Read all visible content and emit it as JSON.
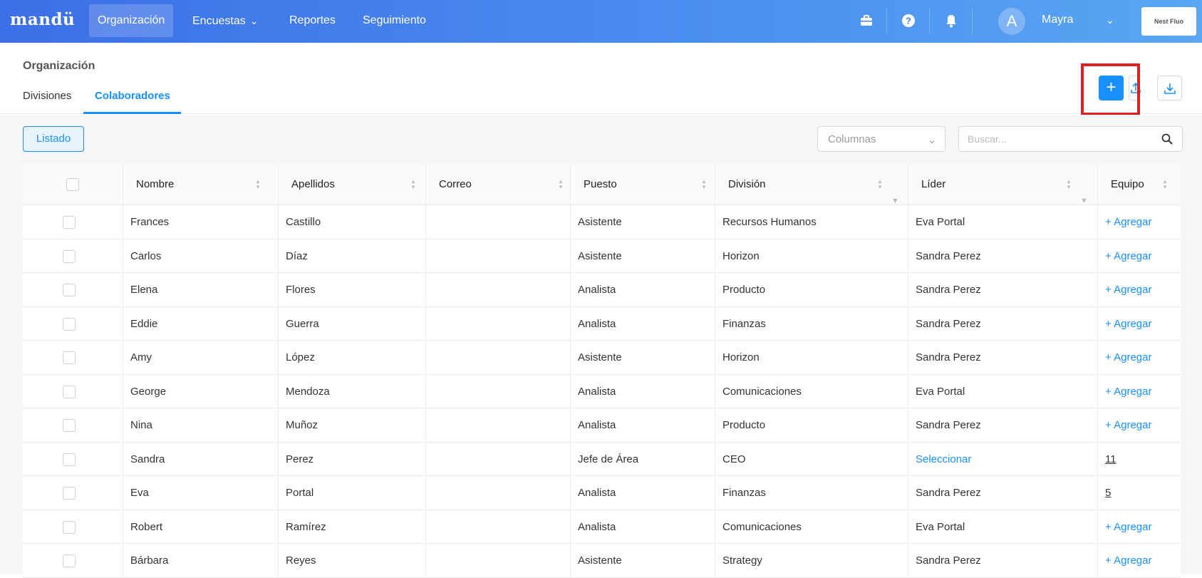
{
  "topbar": {
    "logo": "mandü",
    "nav": [
      {
        "label": "Organización",
        "active": true
      },
      {
        "label": "Encuestas",
        "dropdown": true
      },
      {
        "label": "Reportes"
      },
      {
        "label": "Seguimiento"
      }
    ],
    "icons": [
      "briefcase-icon",
      "help-icon",
      "bell-icon"
    ],
    "avatar_initial": "A",
    "user_name": "Mayra",
    "company_label": "Nest Fluo"
  },
  "page": {
    "title": "Organización",
    "tabs": [
      {
        "label": "Divisiones",
        "active": false
      },
      {
        "label": "Colaboradores",
        "active": true
      }
    ],
    "actions": {
      "add": "+"
    }
  },
  "toolbar": {
    "listado_label": "Listado",
    "columns_placeholder": "Columnas",
    "search_placeholder": "Buscar..."
  },
  "table": {
    "columns": [
      "Nombre",
      "Apellidos",
      "Correo",
      "Puesto",
      "División",
      "Líder",
      "Equipo"
    ],
    "rows": [
      {
        "nombre": "Frances",
        "apellidos": "Castillo",
        "correo": "",
        "puesto": "Asistente",
        "division": "Recursos Humanos",
        "lider": "Eva Portal",
        "lider_link": false,
        "equipo": "+ Agregar",
        "equipo_type": "add"
      },
      {
        "nombre": "Carlos",
        "apellidos": "Díaz",
        "correo": "",
        "puesto": "Asistente",
        "division": "Horizon",
        "lider": "Sandra Perez",
        "lider_link": false,
        "equipo": "+ Agregar",
        "equipo_type": "add"
      },
      {
        "nombre": "Elena",
        "apellidos": "Flores",
        "correo": "",
        "puesto": "Analista",
        "division": "Producto",
        "lider": "Sandra Perez",
        "lider_link": false,
        "equipo": "+ Agregar",
        "equipo_type": "add"
      },
      {
        "nombre": "Eddie",
        "apellidos": "Guerra",
        "correo": "",
        "puesto": "Analista",
        "division": "Finanzas",
        "lider": "Sandra Perez",
        "lider_link": false,
        "equipo": "+ Agregar",
        "equipo_type": "add"
      },
      {
        "nombre": "Amy",
        "apellidos": "López",
        "correo": "",
        "puesto": "Asistente",
        "division": "Horizon",
        "lider": "Sandra Perez",
        "lider_link": false,
        "equipo": "+ Agregar",
        "equipo_type": "add"
      },
      {
        "nombre": "George",
        "apellidos": "Mendoza",
        "correo": "",
        "puesto": "Analista",
        "division": "Comunicaciones",
        "lider": "Eva Portal",
        "lider_link": false,
        "equipo": "+ Agregar",
        "equipo_type": "add"
      },
      {
        "nombre": "Nina",
        "apellidos": "Muñoz",
        "correo": "",
        "puesto": "Analista",
        "division": "Producto",
        "lider": "Sandra Perez",
        "lider_link": false,
        "equipo": "+ Agregar",
        "equipo_type": "add"
      },
      {
        "nombre": "Sandra",
        "apellidos": "Perez",
        "correo": "",
        "puesto": "Jefe de Área",
        "division": "CEO",
        "lider": "Seleccionar",
        "lider_link": true,
        "equipo": "11",
        "equipo_type": "count"
      },
      {
        "nombre": "Eva",
        "apellidos": "Portal",
        "correo": "",
        "puesto": "Analista",
        "division": "Finanzas",
        "lider": "Sandra Perez",
        "lider_link": false,
        "equipo": "5",
        "equipo_type": "count"
      },
      {
        "nombre": "Robert",
        "apellidos": "Ramírez",
        "correo": "",
        "puesto": "Analista",
        "division": "Comunicaciones",
        "lider": "Eva Portal",
        "lider_link": false,
        "equipo": "+ Agregar",
        "equipo_type": "add"
      },
      {
        "nombre": "Bárbara",
        "apellidos": "Reyes",
        "correo": "",
        "puesto": "Asistente",
        "division": "Strategy",
        "lider": "Sandra Perez",
        "lider_link": false,
        "equipo": "+ Agregar",
        "equipo_type": "add"
      }
    ]
  },
  "colors": {
    "accent": "#1890ff",
    "topbar_start": "#3d6fe6",
    "topbar_end": "#5aa6f2",
    "highlight": "#e02020"
  }
}
